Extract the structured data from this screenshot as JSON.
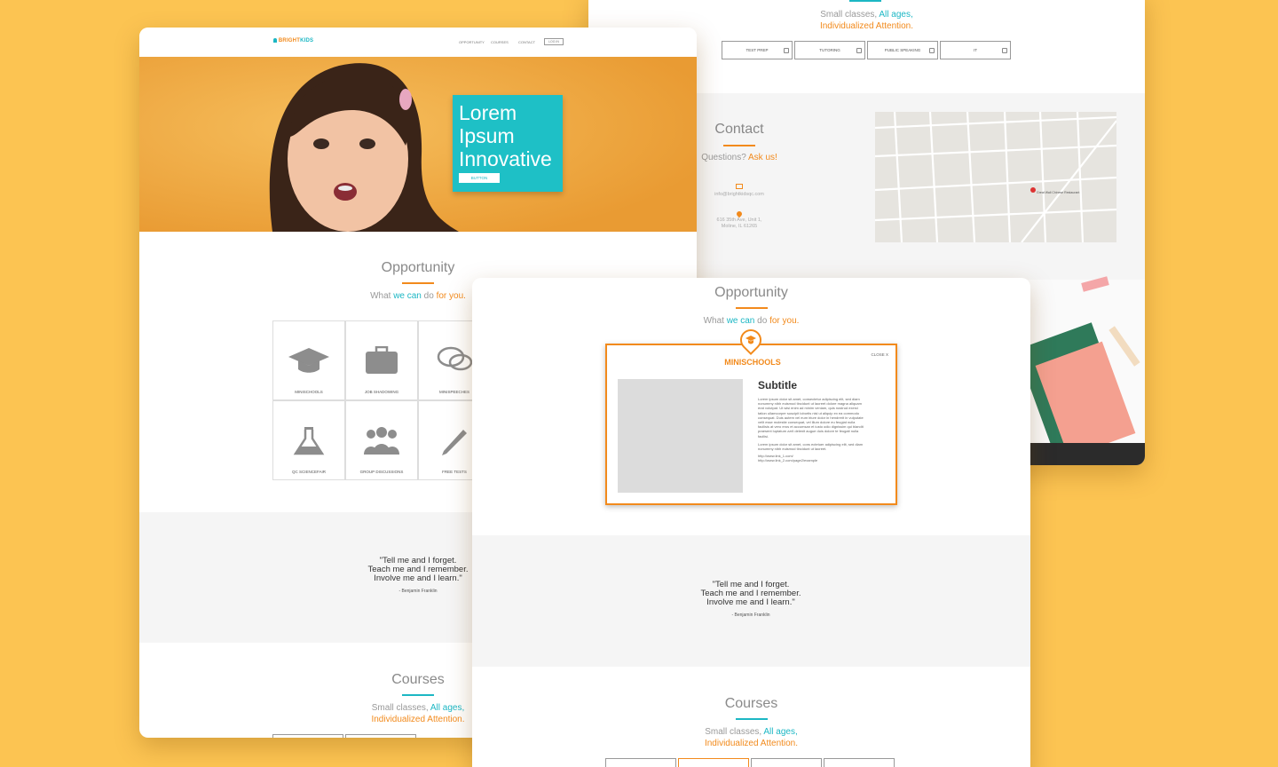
{
  "brand": {
    "name_a": "BRIGHT",
    "name_b": "KIDS"
  },
  "nav": {
    "items": [
      "OPPORTUNITY",
      "COURSES",
      "CONTACT"
    ],
    "login": "LOG IN"
  },
  "hero": {
    "line1": "Lorem",
    "line2": "Ipsum",
    "line3": "Innovative",
    "button": "BUTTON"
  },
  "opportunity": {
    "title": "Opportunity",
    "sub_what": "What ",
    "sub_we_can": "we can",
    "sub_do": " do ",
    "sub_for_you": "for you.",
    "tiles": [
      "MINISCHOOLS",
      "JOB SHADOWING",
      "MINISPEECHES",
      "QC SCIENCEFAIR",
      "GROUP DISCUSSIONS",
      "FREE TESTS"
    ]
  },
  "quote": {
    "line1": "\"Tell me and I forget.",
    "line2": "Teach me and I remember.",
    "line3": "Involve me and I learn.\"",
    "author": "- Benjamin Franklin"
  },
  "courses": {
    "title": "Courses",
    "sub_small": "Small classes, ",
    "sub_all": "All ages,",
    "sub_line2": "Individualized Attention.",
    "buttons": [
      "TEST PREP",
      "TUTORING",
      "PUBLIC SPEAKING",
      "IT"
    ]
  },
  "contact": {
    "title": "Contact",
    "sub_q": "Questions? ",
    "sub_ask": "Ask us!",
    "email": "info@brightkidsqc.com",
    "address1": "616 35th Ave, Unit 1,",
    "address2": "Moline, IL 61265",
    "map_place": "Great Wall Chinese Restaurant"
  },
  "modal": {
    "title": "MINISCHOOLS",
    "close": "CLOSE X",
    "subtitle": "Subtitle",
    "para1": "Lorem ipsum dolor sit amet, consectetur adipiscing elit, sed diam nonummy nibh euismod tincidunt ut laoreet dolore magna aliquam erat volutpat. Ut wisi enim ad minim veniam, quis nostrud exerci tation ullamcorper suscipit lobortis nisl ut aliquip ex ea commodo consequat. Duis autem vel eum iriure dolor in hendrerit in vulputate velit esse molestie consequat, vel illum dolore eu feugiat nulla facilisis at vero eros et accumsan et iusto odio dignissim qui blandit praesent luptatum zzril delenit augue duis dolore te feugait nulla facilisi.",
    "para2": "Lorem ipsum dolor sit amet, cons ectetuer adipiscing elit, sed diam nonummy nibh euismod tincidunt ut laoreet.",
    "link1": "http://www.link_1.com/",
    "link2": "http://www.link_2.com/page2/example"
  },
  "colors": {
    "background": "#fcc452",
    "orange": "#f28a1c",
    "teal": "#1cb7c4"
  }
}
